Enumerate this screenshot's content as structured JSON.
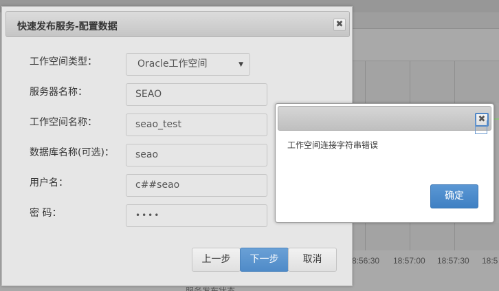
{
  "background": {
    "chart_ticks": [
      "8:56:30",
      "18:57:00",
      "18:57:30",
      "18:5"
    ],
    "bottom_text": "服务发布状态"
  },
  "dialog": {
    "title": "快速发布服务-配置数据",
    "close_icon": "close-icon",
    "fields": {
      "workspace_type": {
        "label": "工作空间类型：",
        "value": "Oracle工作空间"
      },
      "server_name": {
        "label": "服务器名称：",
        "value": "SEAO"
      },
      "workspace_name": {
        "label": "工作空间名称：",
        "value": "seao_test"
      },
      "database_name": {
        "label": "数据库名称(可选)：",
        "value": "seao"
      },
      "username": {
        "label": "用户名：",
        "value": "c##seao"
      },
      "password": {
        "label": "密 码：",
        "value": "••••"
      }
    },
    "buttons": {
      "prev": "上一步",
      "next": "下一步",
      "cancel": "取消"
    },
    "colors": {
      "primary": "#5a97d4"
    }
  },
  "alert": {
    "message": "工作空间连接字符串错误",
    "ok": "确定"
  }
}
